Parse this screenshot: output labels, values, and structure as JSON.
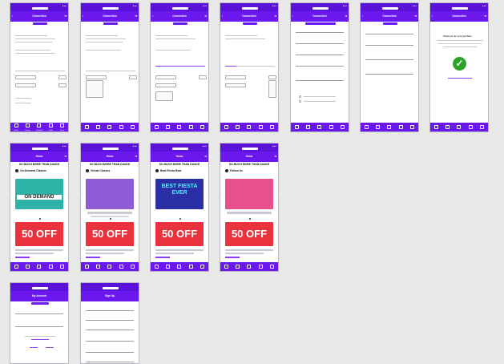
{
  "headers": {
    "checkout": "Connection",
    "home": "Home",
    "account": "My Account",
    "signup": "Sign Up"
  },
  "nav_items": [
    "Home",
    "Classes",
    "Schedule",
    "Profile",
    "More"
  ],
  "nav_icons": [
    "home-icon",
    "classes-icon",
    "schedule-icon",
    "profile-icon",
    "settings-icon"
  ],
  "thank_you": "Thank you for your purchase",
  "home": {
    "brand": "SO MUCH MORE THAN DANCE",
    "slides": [
      {
        "label": "On-Demand Classes",
        "hero_text": "ON DEMAND",
        "hero_color": "#2fb3a8"
      },
      {
        "label": "Virtual Classes",
        "hero_text": "",
        "hero_color": "#8d5bd3"
      },
      {
        "label": "Beat Fiesta Beat",
        "hero_text": "BEST FIESTA EVER",
        "hero_color": "#2b2fa6"
      },
      {
        "label": "Follow Us",
        "hero_text": "",
        "hero_color": "#e94f8b"
      }
    ],
    "promo": "50 OFF"
  },
  "colors": {
    "accent": "#6a18ee",
    "status_bar": "#5b12d8",
    "success": "#2aa52a",
    "promo": "#e9323e"
  }
}
